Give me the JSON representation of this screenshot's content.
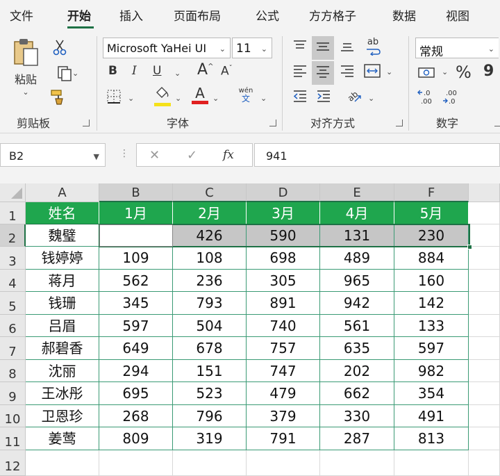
{
  "menu": {
    "items": [
      "文件",
      "开始",
      "插入",
      "页面布局",
      "公式",
      "方方格子",
      "数据",
      "视图"
    ],
    "active_index": 1
  },
  "ribbon": {
    "clipboard": {
      "paste_label": "粘贴",
      "group_label": "剪贴板"
    },
    "font": {
      "font_name": "Microsoft YaHei UI",
      "font_size": "11",
      "bold": "B",
      "italic": "I",
      "underline": "U",
      "grow": "A",
      "shrink": "A",
      "phonetic_top": "wén",
      "phonetic_bottom": "文",
      "font_color_glyph": "A",
      "group_label": "字体",
      "highlight_color": "#f5e11a",
      "font_color": "#e02020"
    },
    "alignment": {
      "wrap_label": "ab",
      "group_label": "对齐方式"
    },
    "number": {
      "format": "常规",
      "percent": "%",
      "comma": "9",
      "group_label": "数字",
      "inc_decimal": ".00",
      "dec_decimal": ".0"
    }
  },
  "formula_bar": {
    "name_box": "B2",
    "cancel": "✕",
    "enter": "✓",
    "fx": "fx",
    "value": "941"
  },
  "sheet": {
    "columns": [
      "A",
      "B",
      "C",
      "D",
      "E",
      "F"
    ],
    "rows": [
      "1",
      "2",
      "3",
      "4",
      "5",
      "6",
      "7",
      "8",
      "9",
      "10",
      "11",
      "12"
    ],
    "header": [
      "姓名",
      "1月",
      "2月",
      "3月",
      "4月",
      "5月"
    ],
    "data": [
      [
        "魏璧",
        "941",
        "426",
        "590",
        "131",
        "230"
      ],
      [
        "钱婷婷",
        "109",
        "108",
        "698",
        "489",
        "884"
      ],
      [
        "蒋月",
        "562",
        "236",
        "305",
        "965",
        "160"
      ],
      [
        "钱珊",
        "345",
        "793",
        "891",
        "942",
        "142"
      ],
      [
        "吕眉",
        "597",
        "504",
        "740",
        "561",
        "133"
      ],
      [
        "郝碧香",
        "649",
        "678",
        "757",
        "635",
        "597"
      ],
      [
        "沈丽",
        "294",
        "151",
        "747",
        "202",
        "982"
      ],
      [
        "王冰彤",
        "695",
        "523",
        "479",
        "662",
        "354"
      ],
      [
        "卫恩珍",
        "268",
        "796",
        "379",
        "330",
        "491"
      ],
      [
        "姜莺",
        "809",
        "319",
        "791",
        "287",
        "813"
      ]
    ],
    "header_color": "#1fa64e",
    "selection_color": "#1e7145"
  }
}
